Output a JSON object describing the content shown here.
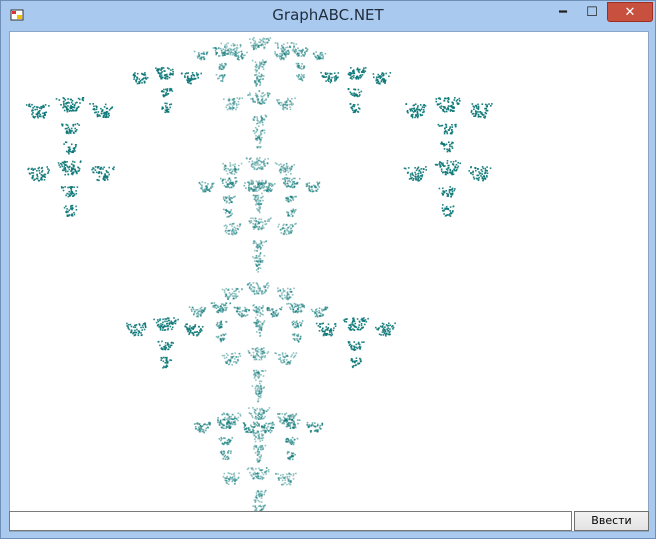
{
  "window": {
    "title": "GraphABC.NET",
    "icons": {
      "app": "app-icon",
      "minimize": "minimize-icon",
      "maximize": "maximize-icon",
      "close": "close-icon"
    }
  },
  "input": {
    "value": ""
  },
  "submit_button": {
    "label": "Ввести"
  },
  "colors": {
    "fractal": "#0b7777",
    "client_bg": "#ffffff",
    "chrome": "#a9c9ee"
  }
}
